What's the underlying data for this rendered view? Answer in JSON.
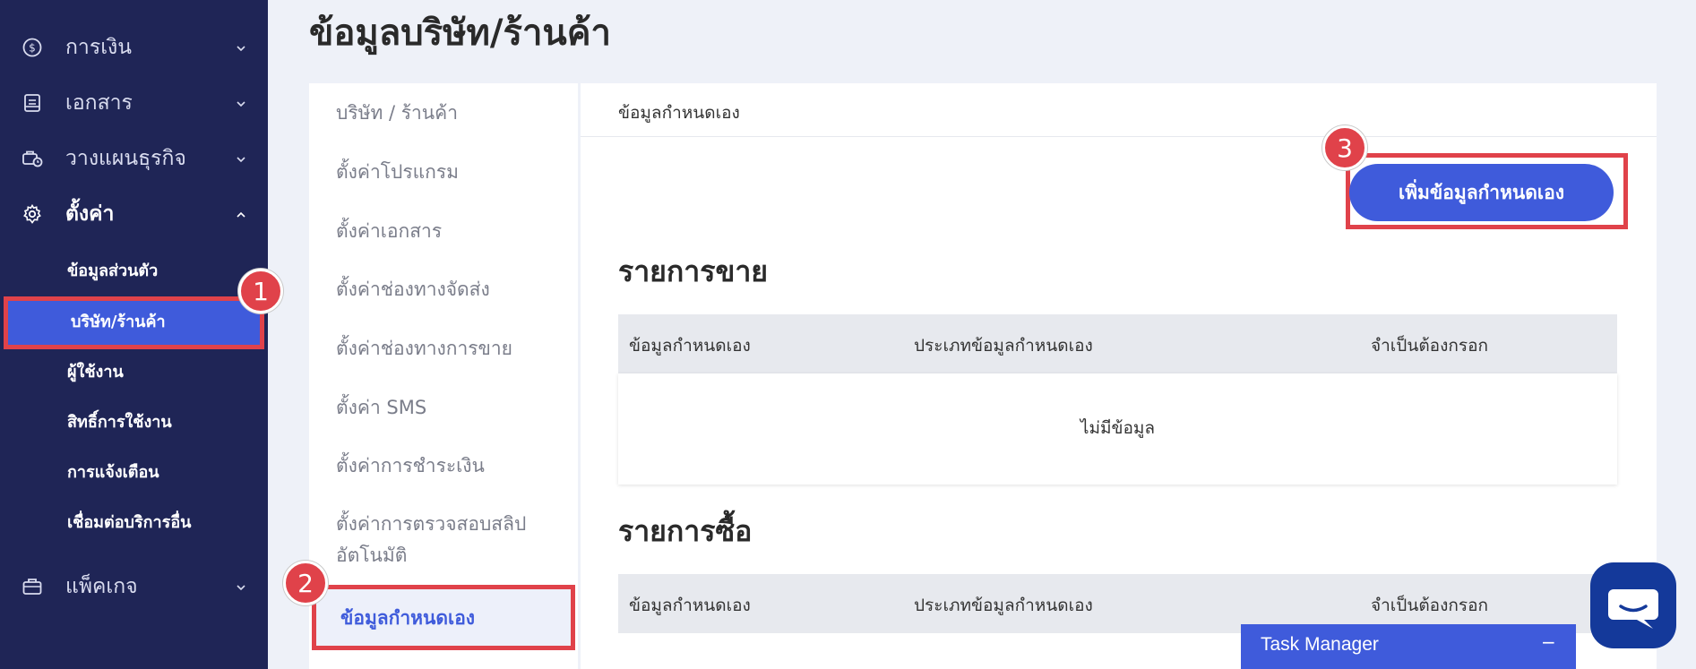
{
  "sidebar": {
    "items": [
      {
        "label": "การเงิน",
        "icon": "dollar-circle-icon"
      },
      {
        "label": "เอกสาร",
        "icon": "document-icon"
      },
      {
        "label": "วางแผนธุรกิจ",
        "icon": "briefcase-clock-icon"
      },
      {
        "label": "ตั้งค่า",
        "icon": "gear-icon"
      },
      {
        "label": "แพ็คเกจ",
        "icon": "package-icon"
      }
    ],
    "sub_items": [
      {
        "label": "ข้อมูลส่วนตัว"
      },
      {
        "label": "บริษัท/ร้านค้า"
      },
      {
        "label": "ผู้ใช้งาน"
      },
      {
        "label": "สิทธิ์การใช้งาน"
      },
      {
        "label": "การแจ้งเตือน"
      },
      {
        "label": "เชื่อมต่อบริการอื่น"
      }
    ]
  },
  "steps": [
    "1",
    "2",
    "3"
  ],
  "page": {
    "title": "ข้อมูลบริษัท/ร้านค้า"
  },
  "settings_menu": {
    "items": [
      {
        "label": "บริษัท / ร้านค้า"
      },
      {
        "label": "ตั้งค่าโปรแกรม"
      },
      {
        "label": "ตั้งค่าเอกสาร"
      },
      {
        "label": "ตั้งค่าช่องทางจัดส่ง"
      },
      {
        "label": "ตั้งค่าช่องทางการขาย"
      },
      {
        "label": "ตั้งค่า SMS"
      },
      {
        "label": "ตั้งค่าการชำระเงิน"
      },
      {
        "label": "ตั้งค่าการตรวจสอบสลิป"
      },
      {
        "label": "อัตโนมัติ"
      },
      {
        "label": "ข้อมูลกำหนดเอง"
      }
    ]
  },
  "content": {
    "header": "ข้อมูลกำหนดเอง",
    "add_button": "เพิ่มข้อมูลกำหนดเอง",
    "sales": {
      "title": "รายการขาย",
      "columns": [
        "ข้อมูลกำหนดเอง",
        "ประเภทข้อมูลกำหนดเอง",
        "จำเป็นต้องกรอก"
      ],
      "empty": "ไม่มีข้อมูล"
    },
    "purchase": {
      "title": "รายการซื้อ",
      "columns": [
        "ข้อมูลกำหนดเอง",
        "ประเภทข้อมูลกำหนดเอง",
        "จำเป็นต้องกรอก"
      ]
    }
  },
  "task_manager": {
    "label": "Task Manager",
    "minimize": "−"
  },
  "colors": {
    "sidebar": "#1f2556",
    "accent": "#3f5bdb",
    "highlight": "#e0424a",
    "background": "#eef1f8",
    "chat": "#14399a"
  }
}
